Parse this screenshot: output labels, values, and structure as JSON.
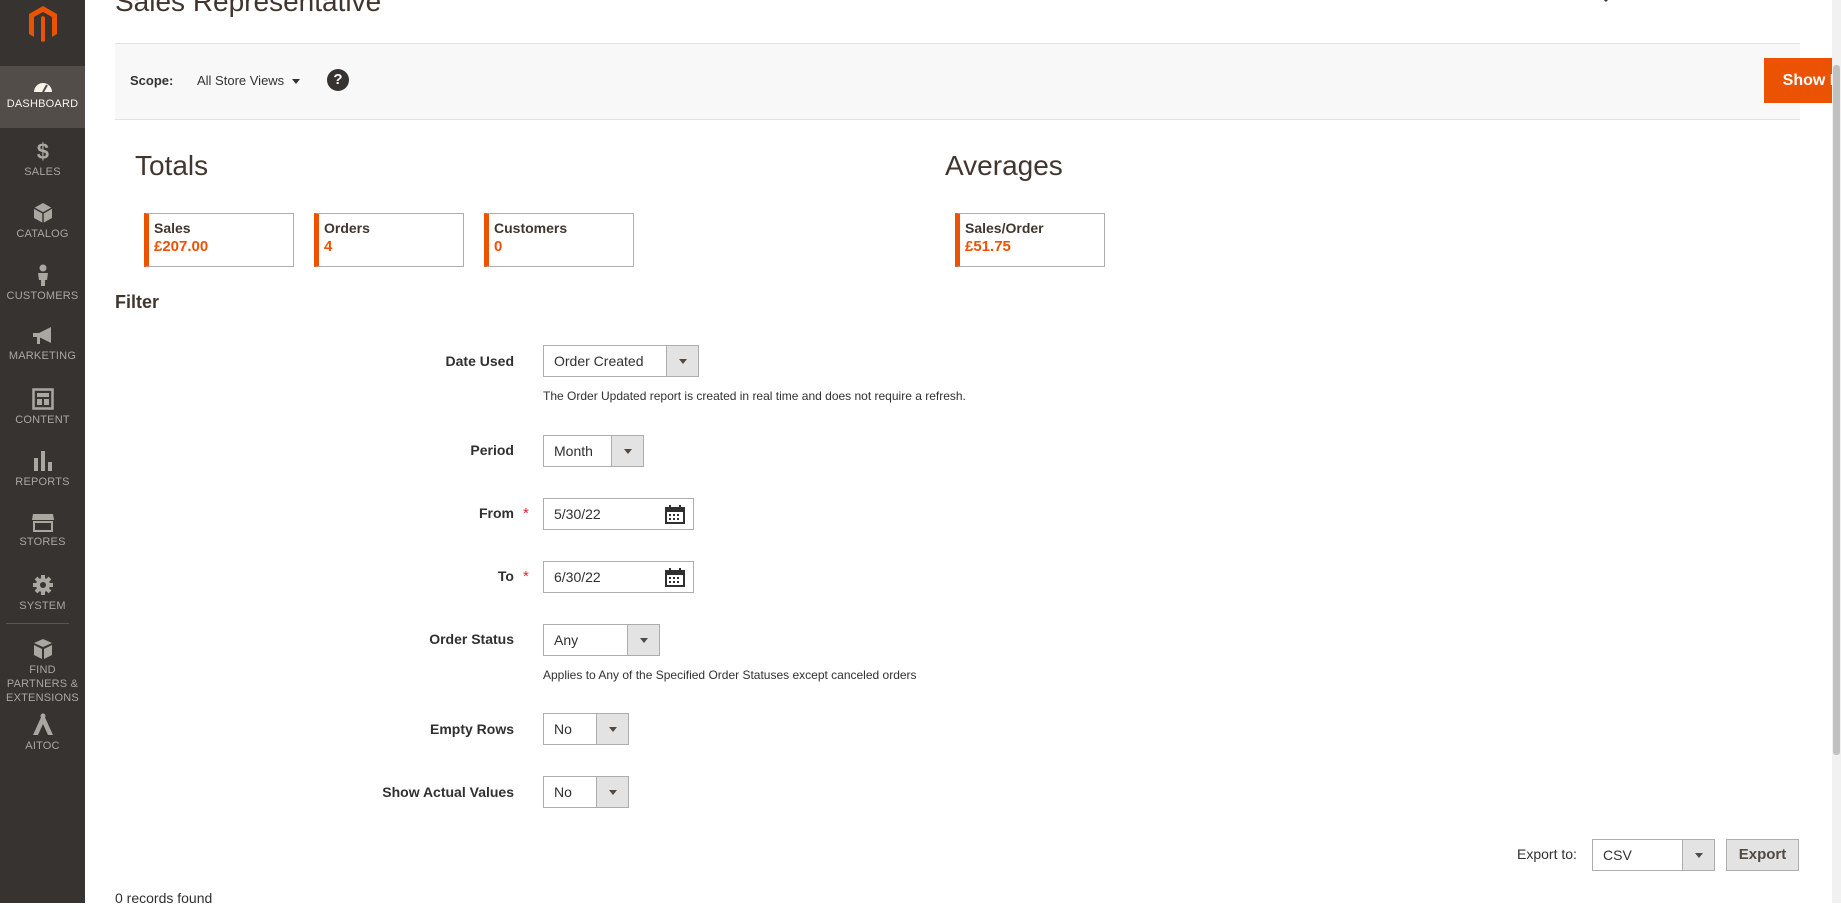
{
  "header": {
    "title": "Sales Representative"
  },
  "sidebar": {
    "items": [
      {
        "label": "DASHBOARD",
        "icon": "dashboard-icon"
      },
      {
        "label": "SALES",
        "icon": "dollar-icon"
      },
      {
        "label": "CATALOG",
        "icon": "box-icon"
      },
      {
        "label": "CUSTOMERS",
        "icon": "person-icon"
      },
      {
        "label": "MARKETING",
        "icon": "megaphone-icon"
      },
      {
        "label": "CONTENT",
        "icon": "layout-icon"
      },
      {
        "label": "REPORTS",
        "icon": "bar-chart-icon"
      },
      {
        "label": "STORES",
        "icon": "storefront-icon"
      },
      {
        "label": "SYSTEM",
        "icon": "gear-icon"
      },
      {
        "label": "FIND PARTNERS & EXTENSIONS",
        "icon": "blocks-icon"
      },
      {
        "label": "AITOC",
        "icon": "aitoc-icon"
      }
    ]
  },
  "scope": {
    "label": "Scope:",
    "value": "All Store Views",
    "help": "?"
  },
  "actions": {
    "show_report": "Show Report"
  },
  "totals": {
    "title": "Totals",
    "items": [
      {
        "label": "Sales",
        "value": "£207.00"
      },
      {
        "label": "Orders",
        "value": "4"
      },
      {
        "label": "Customers",
        "value": "0"
      }
    ]
  },
  "averages": {
    "title": "Averages",
    "items": [
      {
        "label": "Sales/Order",
        "value": "£51.75"
      }
    ]
  },
  "filter": {
    "title": "Filter",
    "date_used": {
      "label": "Date Used",
      "value": "Order Created",
      "note": "The Order Updated report is created in real time and does not require a refresh."
    },
    "period": {
      "label": "Period",
      "value": "Month"
    },
    "from": {
      "label": "From",
      "value": "5/30/22",
      "required": "*"
    },
    "to": {
      "label": "To",
      "value": "6/30/22",
      "required": "*"
    },
    "order_status": {
      "label": "Order Status",
      "value": "Any",
      "note": "Applies to Any of the Specified Order Statuses except canceled orders"
    },
    "empty_rows": {
      "label": "Empty Rows",
      "value": "No"
    },
    "show_actual_values": {
      "label": "Show Actual Values",
      "value": "No"
    }
  },
  "export": {
    "label": "Export to:",
    "format": "CSV",
    "button": "Export"
  },
  "grid": {
    "records": "0 records found"
  },
  "colors": {
    "accent": "#eb5202",
    "sidebar": "#373330"
  }
}
